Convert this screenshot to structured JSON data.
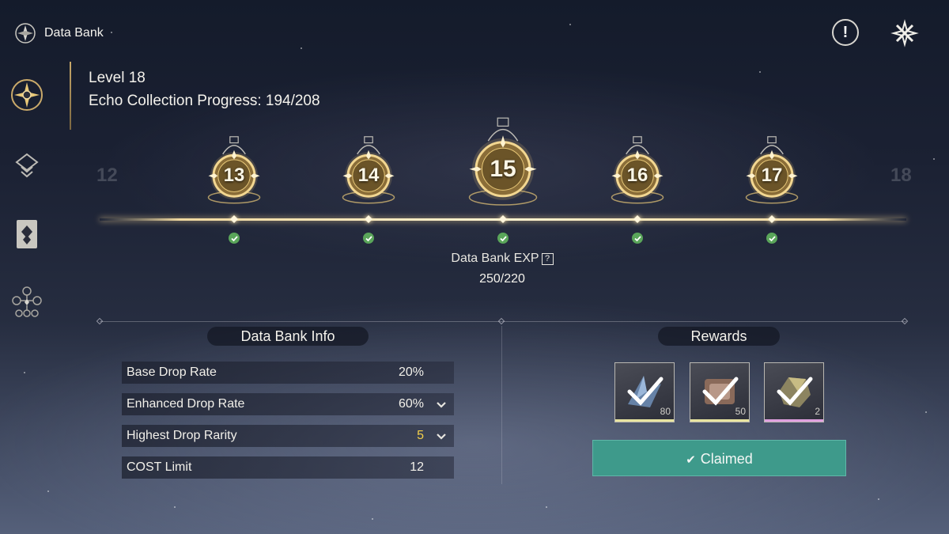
{
  "header": {
    "title": "Data Bank"
  },
  "top_buttons": {
    "alert_symbol": "!"
  },
  "level": {
    "label": "Level 18",
    "progress": "Echo Collection Progress: 194/208"
  },
  "milestones": [
    {
      "level": "13",
      "completed": true
    },
    {
      "level": "14",
      "completed": true
    },
    {
      "level": "15",
      "completed": true,
      "selected": true
    },
    {
      "level": "16",
      "completed": true
    },
    {
      "level": "17",
      "completed": true
    }
  ],
  "ghost_levels": {
    "left": "12",
    "right": "18"
  },
  "exp": {
    "label": "Data Bank EXP",
    "help_symbol": "?",
    "value": "250/220"
  },
  "info": {
    "title": "Data Bank Info",
    "rows": [
      {
        "label": "Base Drop Rate",
        "value": "20%"
      },
      {
        "label": "Enhanced Drop Rate",
        "value": "60%"
      },
      {
        "label": "Highest Drop Rarity",
        "value": "5"
      },
      {
        "label": "COST Limit",
        "value": "12"
      }
    ]
  },
  "rewards": {
    "title": "Rewards",
    "items": [
      {
        "quantity": "80",
        "rarity_color": "#e8e4a0",
        "claimed": true
      },
      {
        "quantity": "50",
        "rarity_color": "#e8e4a0",
        "claimed": true
      },
      {
        "quantity": "2",
        "rarity_color": "#e0a0e0",
        "claimed": true
      }
    ],
    "button_label": "Claimed"
  },
  "colors": {
    "accent_gold": "#e8c878",
    "claimed_teal": "#3e9a8b",
    "check_green": "#5aa55a",
    "highlight_yellow": "#f3cf4a"
  },
  "icons": [
    "data-bank-emblem-icon",
    "alert-icon",
    "close-icon",
    "echo-catalog-icon",
    "sonata-list-icon",
    "echo-card-icon",
    "skill-tree-icon",
    "milestone-badge-icon",
    "check-icon",
    "help-icon",
    "chevron-down-icon"
  ]
}
